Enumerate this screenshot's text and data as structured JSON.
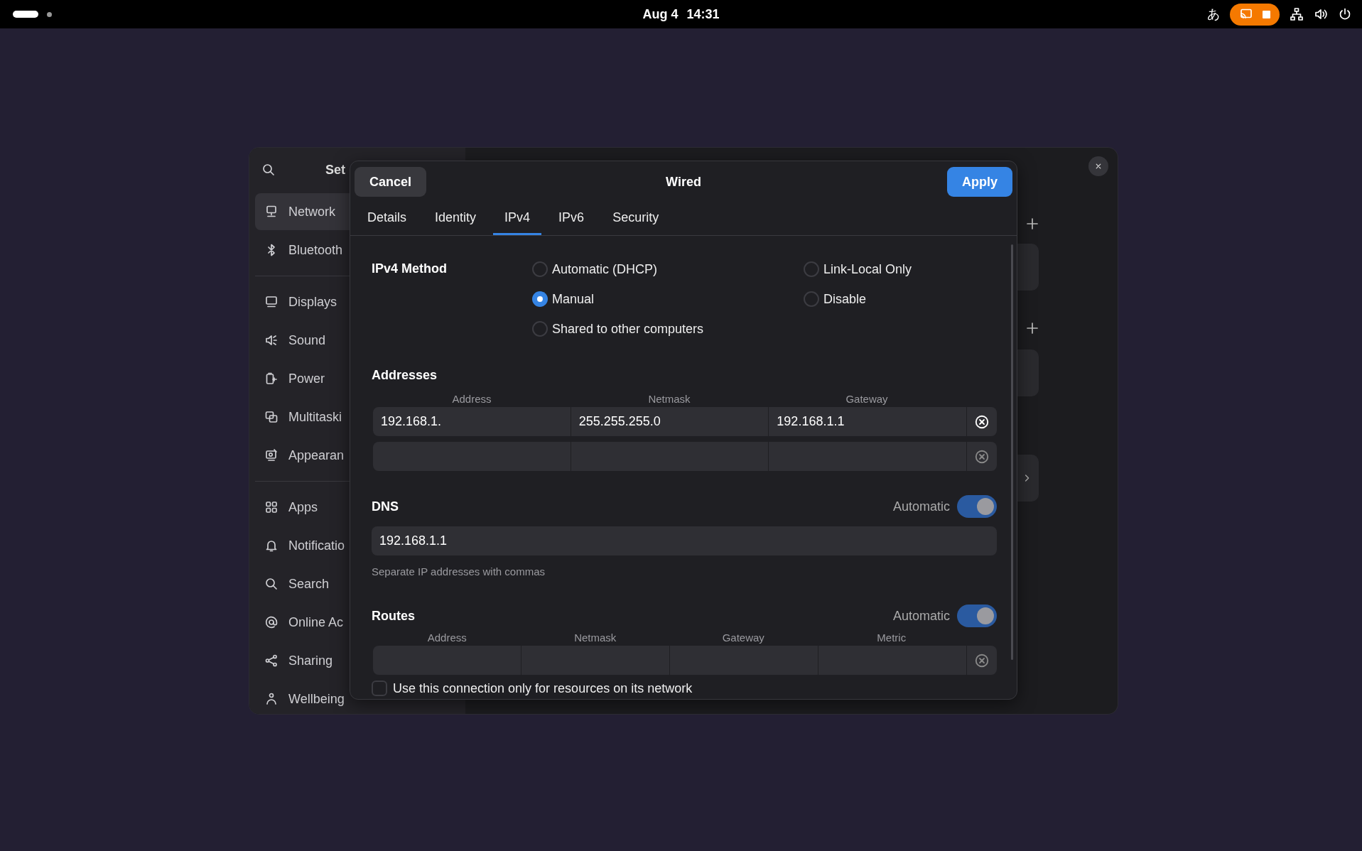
{
  "top_bar": {
    "date": "Aug 4",
    "time": "14:31",
    "input_method": "あ"
  },
  "settings": {
    "title": "Set",
    "sidebar": {
      "groups": [
        {
          "items": [
            {
              "label": "Network",
              "selected": true
            },
            {
              "label": "Bluetooth",
              "selected": false
            }
          ]
        },
        {
          "items": [
            {
              "label": "Displays",
              "selected": false
            },
            {
              "label": "Sound",
              "selected": false
            },
            {
              "label": "Power",
              "selected": false
            },
            {
              "label": "Multitaski",
              "selected": false
            },
            {
              "label": "Appearan",
              "selected": false
            }
          ]
        },
        {
          "items": [
            {
              "label": "Apps",
              "selected": false
            },
            {
              "label": "Notificatio",
              "selected": false
            },
            {
              "label": "Search",
              "selected": false
            },
            {
              "label": "Online Ac",
              "selected": false
            },
            {
              "label": "Sharing",
              "selected": false
            },
            {
              "label": "Wellbeing",
              "selected": false
            }
          ]
        }
      ]
    }
  },
  "dialog": {
    "title": "Wired",
    "cancel": "Cancel",
    "apply": "Apply",
    "tabs": [
      {
        "label": "Details",
        "selected": false
      },
      {
        "label": "Identity",
        "selected": false
      },
      {
        "label": "IPv4",
        "selected": true
      },
      {
        "label": "IPv6",
        "selected": false
      },
      {
        "label": "Security",
        "selected": false
      }
    ],
    "method": {
      "label": "IPv4 Method",
      "options": [
        {
          "label": "Automatic (DHCP)",
          "selected": false
        },
        {
          "label": "Link-Local Only",
          "selected": false
        },
        {
          "label": "Manual",
          "selected": true
        },
        {
          "label": "Disable",
          "selected": false
        },
        {
          "label": "Shared to other computers",
          "selected": false
        }
      ]
    },
    "addresses": {
      "title": "Addresses",
      "columns": [
        "Address",
        "Netmask",
        "Gateway"
      ],
      "rows": [
        {
          "kind": "filled",
          "cells": [
            "192.168.1.",
            "255.255.255.0",
            "192.168.1.1"
          ]
        },
        {
          "kind": "blank"
        }
      ]
    },
    "dns": {
      "title": "DNS",
      "switch_label": "Automatic",
      "on": true,
      "value": "192.168.1.1",
      "hint": "Separate IP addresses with commas"
    },
    "routes": {
      "title": "Routes",
      "switch_label": "Automatic",
      "on": true,
      "columns": [
        "Address",
        "Netmask",
        "Gateway",
        "Metric"
      ],
      "rows": [
        {
          "kind": "blank"
        }
      ]
    },
    "local_only": {
      "label": "Use this connection only for resources on its network",
      "checked": false
    }
  }
}
